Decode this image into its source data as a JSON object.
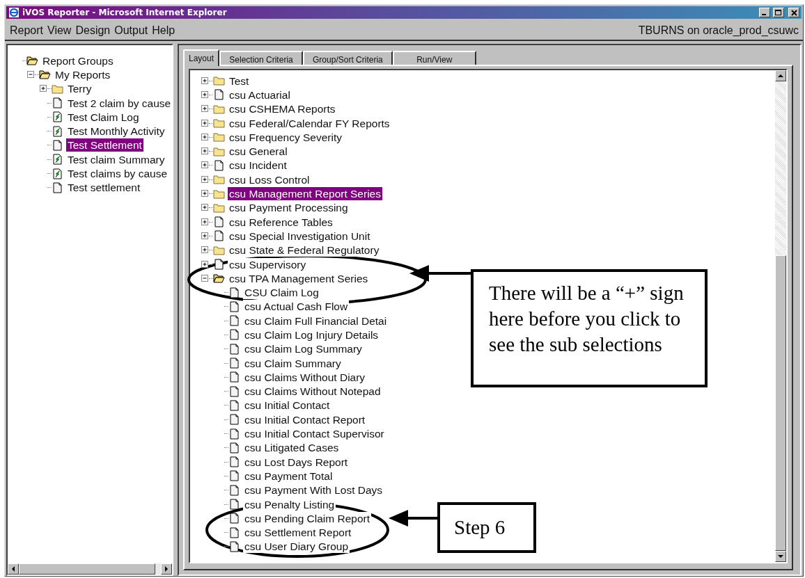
{
  "window": {
    "title": "iVOS Reporter - Microsoft Internet Explorer"
  },
  "menu": [
    "Report",
    "View",
    "Design",
    "Output",
    "Help"
  ],
  "user_label": "TBURNS on oracle_prod_csuwc",
  "sidebar": {
    "items": [
      {
        "label": "Report Groups",
        "kind": "folder",
        "selected": false,
        "children": [
          {
            "label": "My Reports",
            "kind": "folder",
            "expanded": true,
            "selected": false,
            "children": [
              {
                "label": "Terry",
                "kind": "folder",
                "expanded": false,
                "selected": false
              },
              {
                "label": "Test 2 claim by cause",
                "kind": "page",
                "selected": false
              },
              {
                "label": "Test Claim Log",
                "kind": "report",
                "selected": false
              },
              {
                "label": "Test Monthly Activity",
                "kind": "report",
                "selected": false
              },
              {
                "label": "Test Settlement",
                "kind": "page",
                "selected": true
              },
              {
                "label": "Test claim Summary",
                "kind": "report",
                "selected": false
              },
              {
                "label": "Test claims by cause",
                "kind": "report",
                "selected": false
              },
              {
                "label": "Test settlement",
                "kind": "page",
                "selected": false
              }
            ]
          }
        ]
      }
    ]
  },
  "tabs": [
    {
      "label": "Layout",
      "selected": true
    },
    {
      "label": "Selection Criteria",
      "selected": false
    },
    {
      "label": "Group/Sort Criteria",
      "selected": false
    },
    {
      "label": "Run/View",
      "selected": false
    }
  ],
  "tree": {
    "items": [
      {
        "label": "Test",
        "kind": "folder",
        "expanded": false,
        "selected": false
      },
      {
        "label": "csu Actuarial",
        "kind": "page",
        "expanded": false,
        "selected": false
      },
      {
        "label": "csu CSHEMA Reports",
        "kind": "folder",
        "expanded": false,
        "selected": false
      },
      {
        "label": "csu Federal/Calendar FY Reports",
        "kind": "folder",
        "expanded": false,
        "selected": false
      },
      {
        "label": "csu Frequency Severity",
        "kind": "folder",
        "expanded": false,
        "selected": false
      },
      {
        "label": "csu General",
        "kind": "folder",
        "expanded": false,
        "selected": false
      },
      {
        "label": "csu Incident",
        "kind": "page",
        "expanded": false,
        "selected": false
      },
      {
        "label": "csu Loss Control",
        "kind": "folder",
        "expanded": false,
        "selected": false
      },
      {
        "label": "csu Management Report Series",
        "kind": "folder",
        "expanded": false,
        "selected": true
      },
      {
        "label": "csu Payment Processing",
        "kind": "folder",
        "expanded": false,
        "selected": false
      },
      {
        "label": "csu Reference Tables",
        "kind": "page",
        "expanded": false,
        "selected": false
      },
      {
        "label": "csu Special Investigation Unit",
        "kind": "page",
        "expanded": false,
        "selected": false
      },
      {
        "label": "csu State & Federal Regulatory",
        "kind": "folder",
        "expanded": false,
        "selected": false
      },
      {
        "label": "csu Supervisory",
        "kind": "page",
        "expanded": false,
        "selected": false
      },
      {
        "label": "csu TPA Management Series",
        "kind": "folder",
        "expanded": true,
        "selected": false,
        "children": [
          {
            "label": "CSU Claim Log",
            "kind": "page",
            "selected": false
          },
          {
            "label": "csu Actual Cash Flow",
            "kind": "page",
            "selected": false
          },
          {
            "label": "csu Claim Full Financial Detai",
            "kind": "page",
            "selected": false
          },
          {
            "label": "csu Claim Log Injury Details",
            "kind": "page",
            "selected": false
          },
          {
            "label": "csu Claim Log Summary",
            "kind": "page",
            "selected": false
          },
          {
            "label": "csu Claim Summary",
            "kind": "page",
            "selected": false
          },
          {
            "label": "csu Claims Without Diary",
            "kind": "page",
            "selected": false
          },
          {
            "label": "csu Claims Without Notepad",
            "kind": "page",
            "selected": false
          },
          {
            "label": "csu Initial Contact",
            "kind": "page",
            "selected": false
          },
          {
            "label": "csu Initial Contact Report",
            "kind": "page",
            "selected": false
          },
          {
            "label": "csu Initial Contact Supervisor",
            "kind": "page",
            "selected": false
          },
          {
            "label": "csu Litigated Cases",
            "kind": "page",
            "selected": false
          },
          {
            "label": "csu Lost Days Report",
            "kind": "page",
            "selected": false
          },
          {
            "label": "csu Payment Total",
            "kind": "page",
            "selected": false
          },
          {
            "label": "csu Payment With Lost Days",
            "kind": "page",
            "selected": false
          },
          {
            "label": "csu Penalty Listing",
            "kind": "page",
            "selected": false
          },
          {
            "label": "csu Pending Claim Report",
            "kind": "page",
            "selected": false
          },
          {
            "label": "csu Settlement Report",
            "kind": "page",
            "selected": false
          },
          {
            "label": "csu User Diary Group",
            "kind": "page",
            "selected": false
          }
        ]
      }
    ]
  },
  "annotations": [
    {
      "kind": "callout",
      "text": "There will be a “+” sign here before you click to see the sub selections"
    },
    {
      "kind": "callout",
      "text": "Step 6"
    }
  ]
}
